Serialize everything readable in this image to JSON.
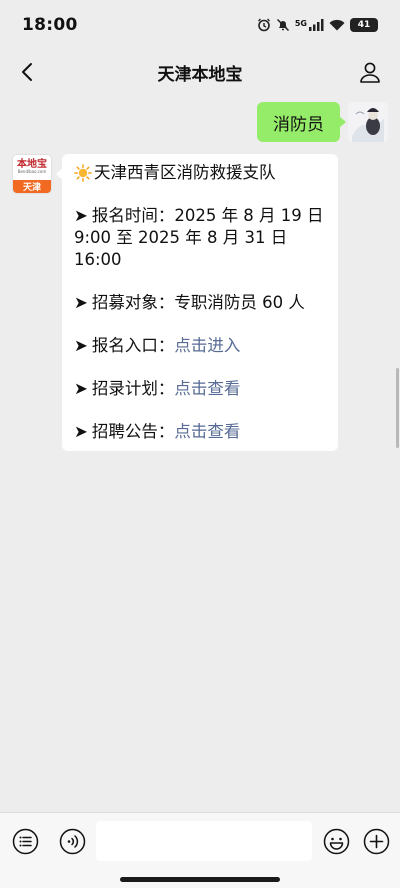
{
  "status_bar": {
    "time": "18:00",
    "network": "5G",
    "battery": "41"
  },
  "nav": {
    "title": "天津本地宝",
    "back_icon": "chevron-left-icon",
    "profile_icon": "person-icon"
  },
  "conversation": {
    "outgoing": {
      "text": "消防员"
    },
    "bot_avatar": {
      "brand": "本地宝",
      "domain": "Bendibao.com",
      "city": "天津"
    },
    "incoming": {
      "title": "天津西青区消防救援支队",
      "arrow": "➤",
      "lines": [
        {
          "label": "报名时间：",
          "value": "2025 年 8 月 19 日 9:00 至 2025 年 8 月 31 日 16:00",
          "link": ""
        },
        {
          "label": "招募对象：",
          "value": "专职消防员 60 人",
          "link": ""
        },
        {
          "label": "报名入口：",
          "value": "",
          "link": "点击进入"
        },
        {
          "label": "招录计划：",
          "value": "",
          "link": "点击查看"
        },
        {
          "label": "招聘公告：",
          "value": "",
          "link": "点击查看"
        }
      ]
    }
  },
  "input_bar": {
    "menu_icon": "list-menu-icon",
    "voice_icon": "voice-icon",
    "emoji_icon": "emoji-icon",
    "plus_icon": "plus-icon",
    "text_value": ""
  },
  "colors": {
    "background": "#ededed",
    "outgoing_bubble": "#95ec69",
    "link": "#576b95",
    "brand_orange": "#f26a21"
  }
}
